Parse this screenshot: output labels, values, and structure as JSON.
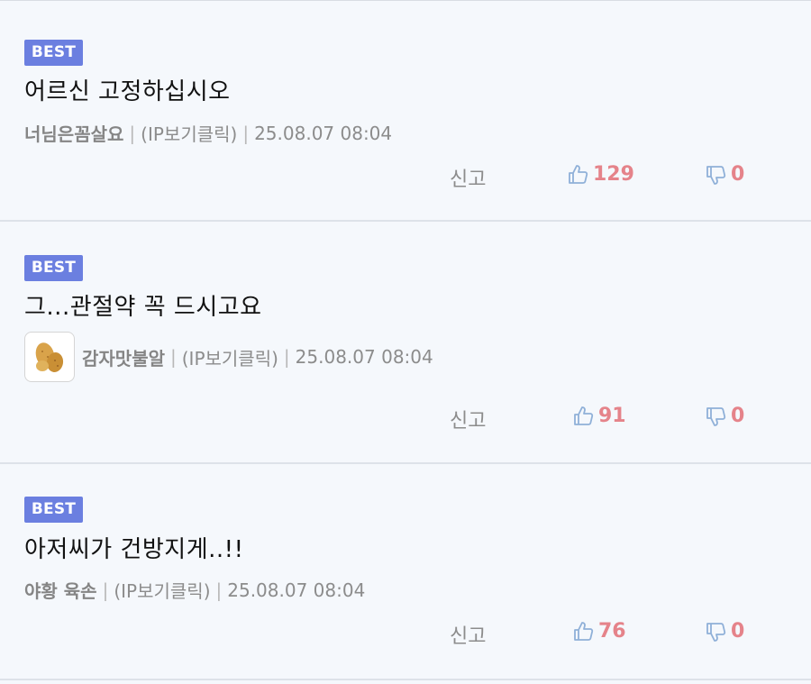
{
  "comments": [
    {
      "badge": "BEST",
      "text": "어르신 고정하십시오",
      "author": "너님은꼼살요",
      "ip": "(IP보기클릭)",
      "datetime": "25.08.07 08:04",
      "report_label": "신고",
      "likes": "129",
      "dislikes": "0",
      "has_avatar": false
    },
    {
      "badge": "BEST",
      "text": "그...관절약 꼭 드시고요",
      "author": "감자맛불알",
      "ip": "(IP보기클릭)",
      "datetime": "25.08.07 08:04",
      "report_label": "신고",
      "likes": "91",
      "dislikes": "0",
      "has_avatar": true,
      "avatar_icon": "potato-icon"
    },
    {
      "badge": "BEST",
      "text": "아저씨가 건방지게..!!",
      "author": "야황 육손",
      "ip": "(IP보기클릭)",
      "datetime": "25.08.07 08:04",
      "report_label": "신고",
      "likes": "76",
      "dislikes": "0",
      "has_avatar": false
    }
  ],
  "colors": {
    "badge": "#6b7fe0",
    "like_count": "#e5838a",
    "thumb_icon": "#8fb0d8",
    "background": "#f5f8fc"
  }
}
